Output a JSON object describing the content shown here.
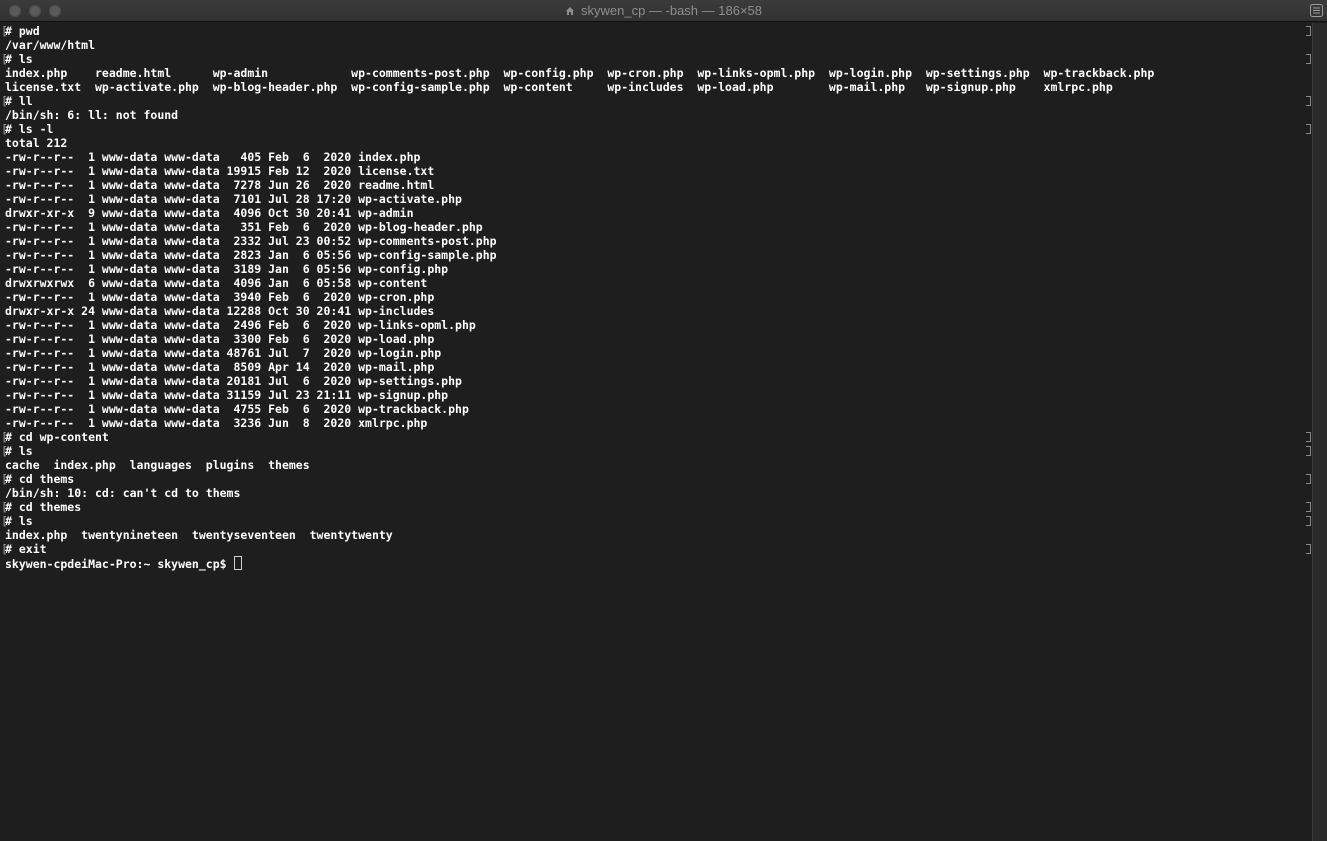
{
  "window": {
    "title": "skywen_cp — -bash — 186×58"
  },
  "colors": {
    "background": "#1e1e1e",
    "text": "#ffffff",
    "titlebar": "#353535"
  },
  "terminal": {
    "lines": [
      {
        "text": "# pwd",
        "prompt": true
      },
      {
        "text": "/var/www/html",
        "prompt": false
      },
      {
        "text": "# ls",
        "prompt": true
      },
      {
        "text": "index.php    readme.html      wp-admin            wp-comments-post.php  wp-config.php  wp-cron.php  wp-links-opml.php  wp-login.php  wp-settings.php  wp-trackback.php",
        "prompt": false
      },
      {
        "text": "license.txt  wp-activate.php  wp-blog-header.php  wp-config-sample.php  wp-content     wp-includes  wp-load.php        wp-mail.php   wp-signup.php    xmlrpc.php",
        "prompt": false
      },
      {
        "text": "# ll",
        "prompt": true
      },
      {
        "text": "/bin/sh: 6: ll: not found",
        "prompt": false
      },
      {
        "text": "# ls -l",
        "prompt": true
      },
      {
        "text": "total 212",
        "prompt": false
      },
      {
        "text": "-rw-r--r--  1 www-data www-data   405 Feb  6  2020 index.php",
        "prompt": false
      },
      {
        "text": "-rw-r--r--  1 www-data www-data 19915 Feb 12  2020 license.txt",
        "prompt": false
      },
      {
        "text": "-rw-r--r--  1 www-data www-data  7278 Jun 26  2020 readme.html",
        "prompt": false
      },
      {
        "text": "-rw-r--r--  1 www-data www-data  7101 Jul 28 17:20 wp-activate.php",
        "prompt": false
      },
      {
        "text": "drwxr-xr-x  9 www-data www-data  4096 Oct 30 20:41 wp-admin",
        "prompt": false
      },
      {
        "text": "-rw-r--r--  1 www-data www-data   351 Feb  6  2020 wp-blog-header.php",
        "prompt": false
      },
      {
        "text": "-rw-r--r--  1 www-data www-data  2332 Jul 23 00:52 wp-comments-post.php",
        "prompt": false
      },
      {
        "text": "-rw-r--r--  1 www-data www-data  2823 Jan  6 05:56 wp-config-sample.php",
        "prompt": false
      },
      {
        "text": "-rw-r--r--  1 www-data www-data  3189 Jan  6 05:56 wp-config.php",
        "prompt": false
      },
      {
        "text": "drwxrwxrwx  6 www-data www-data  4096 Jan  6 05:58 wp-content",
        "prompt": false
      },
      {
        "text": "-rw-r--r--  1 www-data www-data  3940 Feb  6  2020 wp-cron.php",
        "prompt": false
      },
      {
        "text": "drwxr-xr-x 24 www-data www-data 12288 Oct 30 20:41 wp-includes",
        "prompt": false
      },
      {
        "text": "-rw-r--r--  1 www-data www-data  2496 Feb  6  2020 wp-links-opml.php",
        "prompt": false
      },
      {
        "text": "-rw-r--r--  1 www-data www-data  3300 Feb  6  2020 wp-load.php",
        "prompt": false
      },
      {
        "text": "-rw-r--r--  1 www-data www-data 48761 Jul  7  2020 wp-login.php",
        "prompt": false
      },
      {
        "text": "-rw-r--r--  1 www-data www-data  8509 Apr 14  2020 wp-mail.php",
        "prompt": false
      },
      {
        "text": "-rw-r--r--  1 www-data www-data 20181 Jul  6  2020 wp-settings.php",
        "prompt": false
      },
      {
        "text": "-rw-r--r--  1 www-data www-data 31159 Jul 23 21:11 wp-signup.php",
        "prompt": false
      },
      {
        "text": "-rw-r--r--  1 www-data www-data  4755 Feb  6  2020 wp-trackback.php",
        "prompt": false
      },
      {
        "text": "-rw-r--r--  1 www-data www-data  3236 Jun  8  2020 xmlrpc.php",
        "prompt": false
      },
      {
        "text": "# cd wp-content",
        "prompt": true
      },
      {
        "text": "# ls",
        "prompt": true
      },
      {
        "text": "cache  index.php  languages  plugins  themes",
        "prompt": false
      },
      {
        "text": "# cd thems",
        "prompt": true
      },
      {
        "text": "/bin/sh: 10: cd: can't cd to thems",
        "prompt": false
      },
      {
        "text": "# cd themes",
        "prompt": true
      },
      {
        "text": "# ls",
        "prompt": true
      },
      {
        "text": "index.php  twentynineteen  twentyseventeen  twentytwenty",
        "prompt": false
      },
      {
        "text": "# exit",
        "prompt": true
      }
    ],
    "shell_prompt": "skywen-cpdeiMac-Pro:~ skywen_cp$ "
  }
}
